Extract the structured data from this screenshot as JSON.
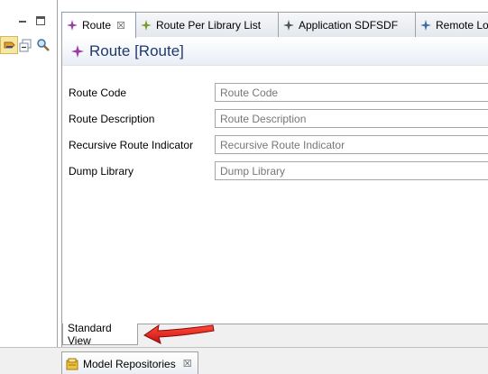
{
  "left_panel": {
    "minimize_icon": "minimize-icon",
    "maximize_icon": "maximize-icon",
    "tools": [
      "link-editor-icon",
      "collapse-icon",
      "search-icon"
    ]
  },
  "editor_tabs": [
    {
      "label": "Route",
      "icon": "star-icon-purple",
      "active": true,
      "closable": true
    },
    {
      "label": "Route Per Library List",
      "icon": "star-icon-green"
    },
    {
      "label": "Application SDFSDF",
      "icon": "star-icon-dark"
    },
    {
      "label": "Remote Lo",
      "icon": "star-icon-blue"
    }
  ],
  "close_glyph": "☒",
  "form": {
    "title": "Route [Route]",
    "fields": [
      {
        "label": "Route Code",
        "placeholder": "Route Code"
      },
      {
        "label": "Route Description",
        "placeholder": "Route Description"
      },
      {
        "label": "Recursive Route Indicator",
        "placeholder": "Recursive Route Indicator"
      },
      {
        "label": "Dump Library",
        "placeholder": "Dump Library"
      }
    ]
  },
  "bottom_tabs": {
    "standard_view": "Standard View"
  },
  "bottom_view": {
    "label": "Model Repositories",
    "icon": "repository-icon"
  },
  "colors": {
    "accent_title": "#1f3a6d",
    "arrow": "#e02020",
    "route_icon": "#9b3aa8"
  }
}
